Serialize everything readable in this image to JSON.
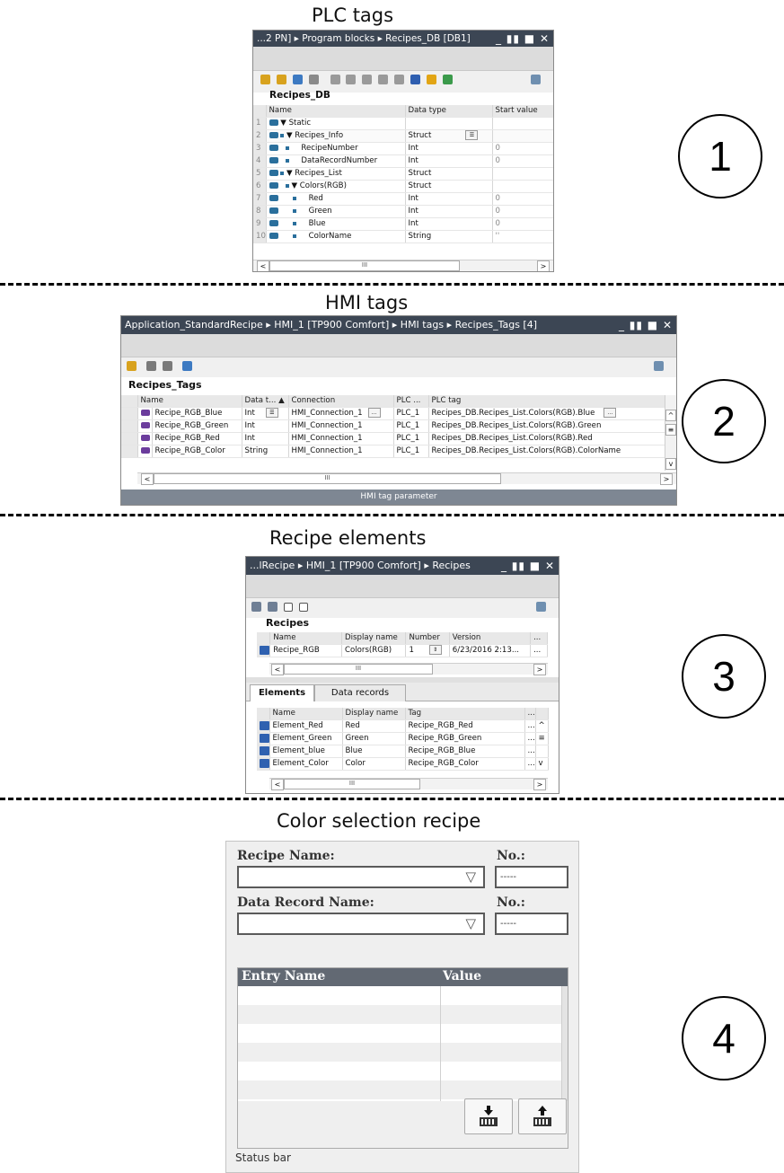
{
  "sections": {
    "plc": {
      "title": "PLC tags",
      "number": "1"
    },
    "hmi": {
      "title": "HMI tags",
      "number": "2"
    },
    "recipe_elements": {
      "title": "Recipe elements",
      "number": "3"
    },
    "color_recipe": {
      "title": "Color selection recipe",
      "number": "4"
    }
  },
  "plc_window": {
    "title": "...2 PN] ▸ Program blocks ▸ Recipes_DB [DB1]",
    "window_controls": "_ ▮▮ ■ ✕",
    "table_name": "Recipes_DB",
    "columns": [
      "Name",
      "Data type",
      "Start value"
    ],
    "rows": [
      {
        "num": "1",
        "name": "▼ Static",
        "type": "",
        "start": ""
      },
      {
        "num": "2",
        "name": "▼ Recipes_Info",
        "type": "Struct",
        "start": ""
      },
      {
        "num": "3",
        "name": "RecipeNumber",
        "type": "Int",
        "start": "0"
      },
      {
        "num": "4",
        "name": "DataRecordNumber",
        "type": "Int",
        "start": "0"
      },
      {
        "num": "5",
        "name": "▼ Recipes_List",
        "type": "Struct",
        "start": ""
      },
      {
        "num": "6",
        "name": "▼ Colors(RGB)",
        "type": "Struct",
        "start": ""
      },
      {
        "num": "7",
        "name": "Red",
        "type": "Int",
        "start": "0"
      },
      {
        "num": "8",
        "name": "Green",
        "type": "Int",
        "start": "0"
      },
      {
        "num": "9",
        "name": "Blue",
        "type": "Int",
        "start": "0"
      },
      {
        "num": "10",
        "name": "ColorName",
        "type": "String",
        "start": "''"
      }
    ],
    "scroll_thumb": "III"
  },
  "hmi_window": {
    "title": "Application_StandardRecipe ▸ HMI_1 [TP900 Comfort] ▸ HMI tags ▸ Recipes_Tags [4]",
    "window_controls": "_ ▮▮ ■ ✕",
    "table_name": "Recipes_Tags",
    "columns": [
      "Name",
      "Data t... ▲",
      "Connection",
      "PLC ...",
      "PLC tag"
    ],
    "rows": [
      {
        "name": "Recipe_RGB_Blue",
        "type": "Int",
        "conn": "HMI_Connection_1",
        "plc": "PLC_1",
        "tag": "Recipes_DB.Recipes_List.Colors(RGB).Blue"
      },
      {
        "name": "Recipe_RGB_Green",
        "type": "Int",
        "conn": "HMI_Connection_1",
        "plc": "PLC_1",
        "tag": "Recipes_DB.Recipes_List.Colors(RGB).Green"
      },
      {
        "name": "Recipe_RGB_Red",
        "type": "Int",
        "conn": "HMI_Connection_1",
        "plc": "PLC_1",
        "tag": "Recipes_DB.Recipes_List.Colors(RGB).Red"
      },
      {
        "name": "Recipe_RGB_Color",
        "type": "String",
        "conn": "HMI_Connection_1",
        "plc": "PLC_1",
        "tag": "Recipes_DB.Recipes_List.Colors(RGB).ColorName"
      }
    ],
    "footer": "HMI tag parameter",
    "scroll_thumb": "III"
  },
  "recipe_window": {
    "title": "...lRecipe ▸ HMI_1 [TP900 Comfort] ▸ Recipes",
    "window_controls": "_ ▮▮ ■ ✕",
    "table_name": "Recipes",
    "columns": [
      "Name",
      "Display name",
      "Number",
      "Version"
    ],
    "recipe_row": {
      "name": "Recipe_RGB",
      "display": "Colors(RGB)",
      "number": "1",
      "version": "6/23/2016 2:13..."
    },
    "tabs": [
      "Elements",
      "Data records"
    ],
    "element_columns": [
      "Name",
      "Display name",
      "Tag"
    ],
    "elements": [
      {
        "name": "Element_Red",
        "display": "Red",
        "tag": "Recipe_RGB_Red"
      },
      {
        "name": "Element_Green",
        "display": "Green",
        "tag": "Recipe_RGB_Green"
      },
      {
        "name": "Element_blue",
        "display": "Blue",
        "tag": "Recipe_RGB_Blue"
      },
      {
        "name": "Element_Color",
        "display": "Color",
        "tag": "Recipe_RGB_Color"
      }
    ],
    "scroll_thumb": "III"
  },
  "recipe_view": {
    "recipe_name_label": "Recipe Name:",
    "recipe_no_label": "No.:",
    "recipe_no_value": "-----",
    "record_name_label": "Data Record Name:",
    "record_no_label": "No.:",
    "record_no_value": "-----",
    "col_entry": "Entry Name",
    "col_value": "Value",
    "status_bar": "Status bar"
  }
}
